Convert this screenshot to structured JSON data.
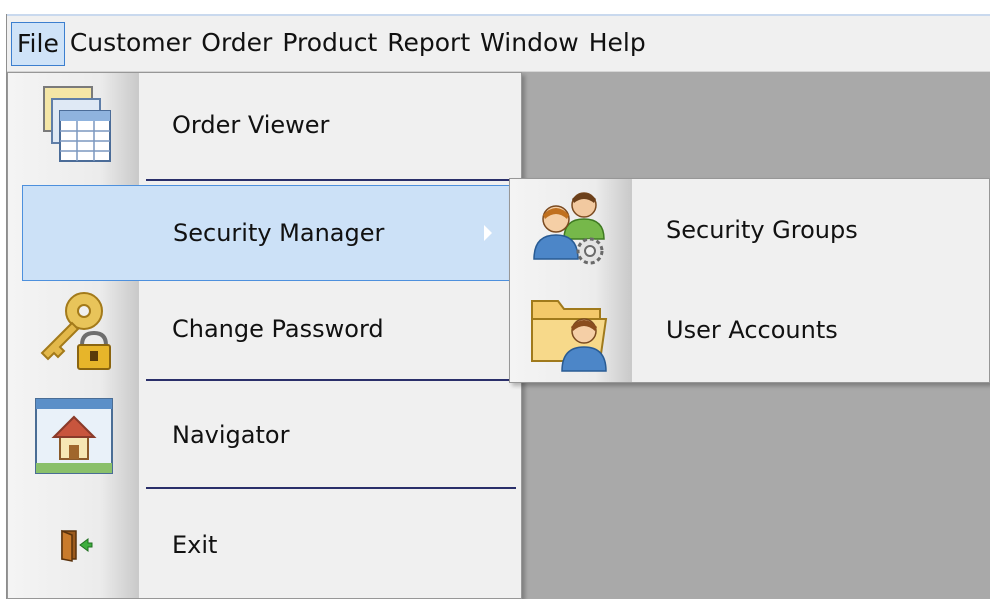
{
  "menubar": {
    "items": [
      "File",
      "Customer",
      "Order",
      "Product",
      "Report",
      "Window",
      "Help"
    ],
    "active": "File"
  },
  "file_menu": {
    "items": [
      {
        "label": "Order Viewer",
        "icon": "spreadsheet-icon"
      },
      {
        "label": "Security Manager",
        "icon": "none",
        "has_submenu": true,
        "highlighted": true
      },
      {
        "label": "Change Password",
        "icon": "key-lock-icon"
      },
      {
        "label": "Navigator",
        "icon": "home-window-icon"
      },
      {
        "label": "Exit",
        "icon": "exit-door-icon"
      }
    ]
  },
  "security_submenu": {
    "items": [
      {
        "label": "Security Groups",
        "icon": "users-gear-icon"
      },
      {
        "label": "User Accounts",
        "icon": "folder-user-icon"
      }
    ]
  },
  "colors": {
    "highlight_bg": "#cce1f7",
    "highlight_border": "#4d90dd",
    "separator": "#2a2f6a",
    "workspace": "#a9a9a9"
  }
}
